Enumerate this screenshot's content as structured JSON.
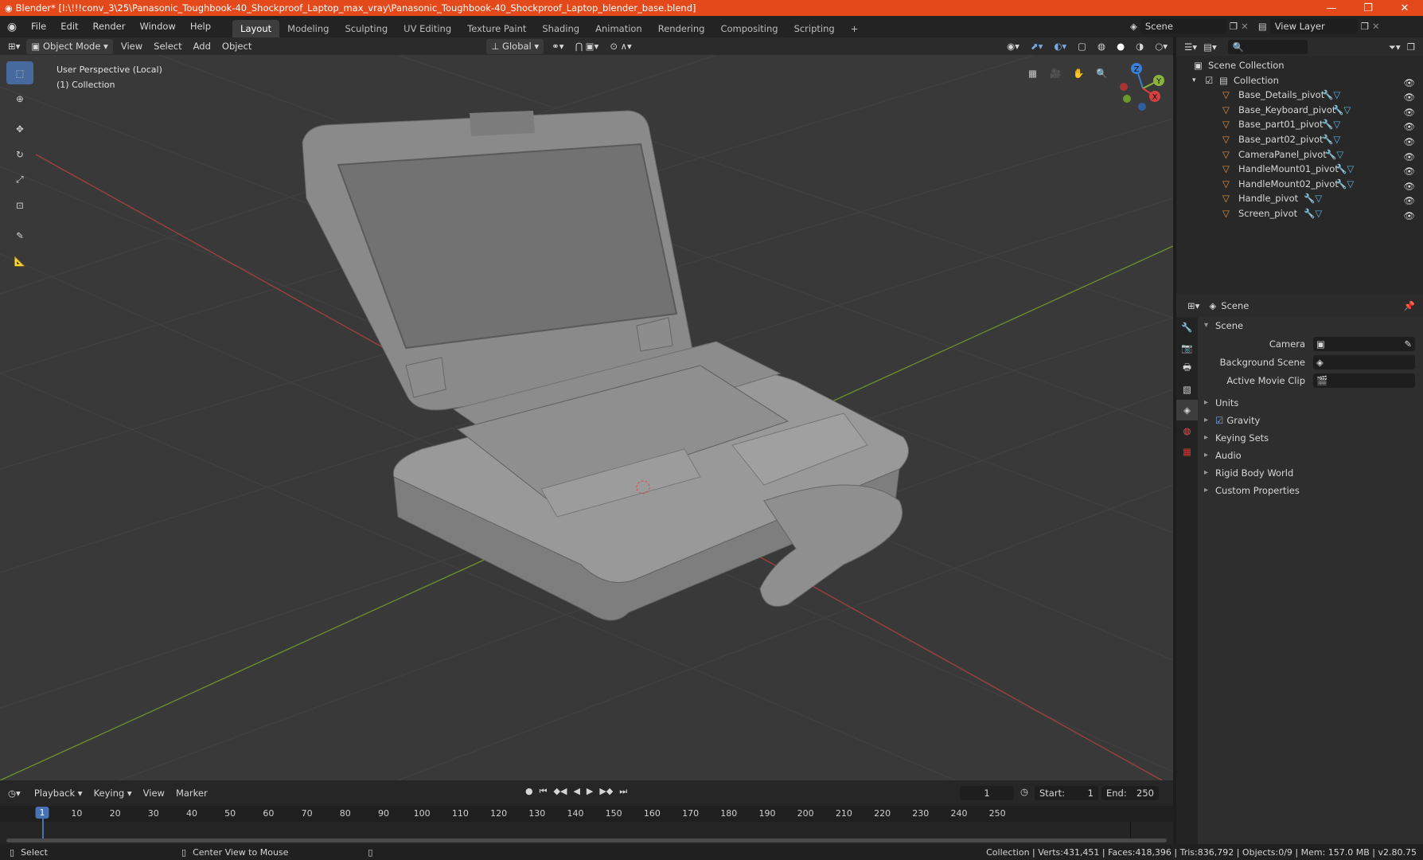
{
  "app": {
    "title": "Blender* [I:\\!!!conv_3\\25\\Panasonic_Toughbook-40_Shockproof_Laptop_max_vray\\Panasonic_Toughbook-40_Shockproof_Laptop_blender_base.blend]"
  },
  "menu": [
    "File",
    "Edit",
    "Render",
    "Window",
    "Help"
  ],
  "workspaces": [
    "Layout",
    "Modeling",
    "Sculpting",
    "UV Editing",
    "Texture Paint",
    "Shading",
    "Animation",
    "Rendering",
    "Compositing",
    "Scripting"
  ],
  "scene_field": "Scene",
  "view_layer_field": "View Layer",
  "viewport_header": {
    "mode": "Object Mode",
    "menus": [
      "View",
      "Select",
      "Add",
      "Object"
    ],
    "transform_orientation": "Global"
  },
  "viewport": {
    "view_name": "User Perspective (Local)",
    "collection": "(1) Collection"
  },
  "gizmo": {
    "x": "X",
    "y": "Y",
    "z": "Z"
  },
  "outliner": {
    "root": "Scene Collection",
    "collection": "Collection",
    "items": [
      "Base_Details_pivot",
      "Base_Keyboard_pivot",
      "Base_part01_pivot",
      "Base_part02_pivot",
      "CameraPanel_pivot",
      "HandleMount01_pivot",
      "HandleMount02_pivot",
      "Handle_pivot",
      "Screen_pivot"
    ]
  },
  "properties": {
    "header": "Scene",
    "panel": "Scene",
    "fields": {
      "camera": "Camera",
      "background_scene": "Background Scene",
      "active_movie_clip": "Active Movie Clip"
    },
    "panels": [
      "Units",
      "Gravity",
      "Keying Sets",
      "Audio",
      "Rigid Body World",
      "Custom Properties"
    ]
  },
  "timeline": {
    "menus": [
      "Playback",
      "Keying",
      "View",
      "Marker"
    ],
    "current_frame": "1",
    "start_label": "Start:",
    "start": "1",
    "end_label": "End:",
    "end": "250",
    "ticks": [
      "10",
      "20",
      "30",
      "40",
      "50",
      "60",
      "70",
      "80",
      "90",
      "100",
      "110",
      "120",
      "130",
      "140",
      "150",
      "160",
      "170",
      "180",
      "190",
      "200",
      "210",
      "220",
      "230",
      "240",
      "250"
    ]
  },
  "status": {
    "left": "Select",
    "mid": "Center View to Mouse",
    "right": "Collection | Verts:431,451 | Faces:418,396 | Tris:836,792 | Objects:0/9 | Mem: 157.0 MB | v2.80.75"
  }
}
